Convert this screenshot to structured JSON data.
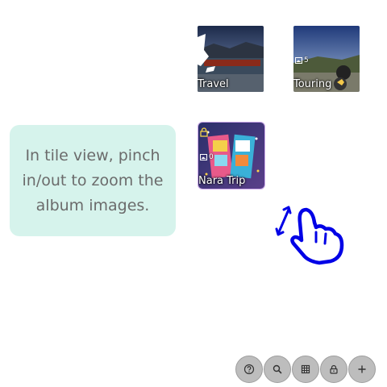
{
  "albums": [
    {
      "name": "Travel",
      "count": "",
      "locked": false
    },
    {
      "name": "Touring",
      "count": "5",
      "locked": false
    },
    {
      "name": "Nara Trip",
      "count": "0",
      "locked": true
    }
  ],
  "hint": {
    "text": "In tile view, pinch in/out to zoom the album images."
  },
  "toolbar": {
    "buttons": [
      {
        "icon": "help-icon"
      },
      {
        "icon": "search-icon"
      },
      {
        "icon": "grid-view-icon"
      },
      {
        "icon": "lock-icon"
      },
      {
        "icon": "add-icon"
      }
    ]
  },
  "colors": {
    "hint_background": "#d6f3ec",
    "hint_text": "#6b6b6b",
    "button_background": "#bdbdbd",
    "gesture_blue": "#0000e6"
  }
}
